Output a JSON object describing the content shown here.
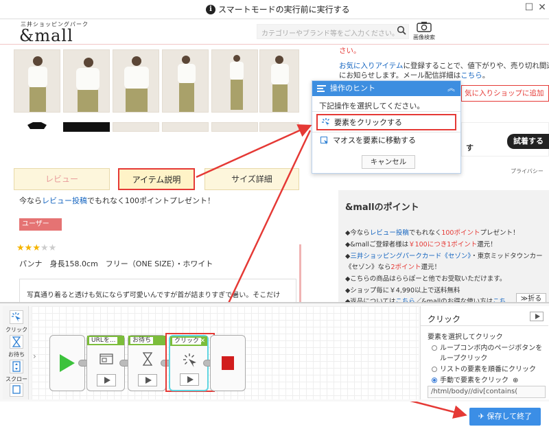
{
  "topbar": {
    "message": "スマートモードの実行前に実行する",
    "info_icon": "i"
  },
  "site": {
    "logo_small": "三井ショッピングパーク",
    "logo": "&mall",
    "search_placeholder": "カテゴリーやブランド等をご入力ください。",
    "image_search_label": "画像検索"
  },
  "tabs": [
    {
      "label": "レビュー"
    },
    {
      "label": "アイテム説明"
    },
    {
      "label": "サイズ詳細"
    }
  ],
  "review": {
    "promo_prefix": "今なら",
    "promo_link": "レビュー投稿",
    "promo_suffix": "でもれなく100ポイントプレゼント！",
    "user_badge": "ユーザー",
    "stars_filled": 3,
    "stars_total": 5,
    "reviewer": "パンナ　身長158.0cm　フリー（ONE SIZE）・ホワイト",
    "comment": "写真通り着ると透けも気にならず可愛いんですが首が詰まりすぎで暑い。そこだけ"
  },
  "right": {
    "notice_tail": "さい。",
    "fav_prefix": "お気に",
    "fav_link": "入りアイテム",
    "fav_text": "に登録することで、値下がりや、売り切れ間近",
    "fav_text2": "にお知らせします。メール配信詳細は",
    "fav_link2": "こちら",
    "fav_tail": "。",
    "fav_shop_btn": "気に入りショップに追加",
    "try_btn": "試着する",
    "su_text": "す",
    "privacy": "プライバシー",
    "points": {
      "title": "&mallのポイント",
      "l1a": "◆今なら",
      "l1link": "レビュー投稿",
      "l1b": "でもれなく",
      "l1c": "100ポイント",
      "l1d": "プレゼント！",
      "l2a": "◆&mallご登録者様は",
      "l2b": "￥100につき1ポイント",
      "l2c": "還元！",
      "l3a": "◆",
      "l3link": "三井ショッピングパークカード《セゾン》",
      "l3b": "・東京ミッドタウンカー",
      "l4a": "《セゾン》なら",
      "l4b": "2ポイント",
      "l4c": "還元！",
      "l5": "◆こちらの商品はららぽーと他でお受取いただけます。",
      "l6": "◆ショップ毎に￥4,990以上で送料無料",
      "l7a": "◆返品については",
      "l7link": "こちら",
      "l7b": "／&mallのお得な使い方は",
      "l7link2": "こち"
    },
    "fold": "折る"
  },
  "hint": {
    "title": "操作のヒント",
    "subtitle": "下記操作を選択してください。",
    "options": [
      {
        "label": "要素をクリックする"
      },
      {
        "label": "マオスを要素に移動する"
      }
    ],
    "cancel": "キャンセル"
  },
  "tools": [
    {
      "label": "クリック"
    },
    {
      "label": "お待ち"
    },
    {
      "label": "スクロール"
    }
  ],
  "flow": [
    {
      "label": "URLを..."
    },
    {
      "label": "お待ち"
    },
    {
      "label": "クリック"
    }
  ],
  "props": {
    "title": "クリック",
    "section": "要素を選択してクリック",
    "opt1": "ループコンボ内のページボタンを",
    "opt1b": "ループクリック",
    "opt2": "リストの要素を順番にクリック",
    "opt3": "手動で要素をクリック",
    "xpath": "/html/body//div[contains("
  },
  "save_button": "保存して終了",
  "colors": {
    "accent": "#3b8ee6",
    "highlight": "#e53935",
    "node_green": "#7cbd3b"
  }
}
